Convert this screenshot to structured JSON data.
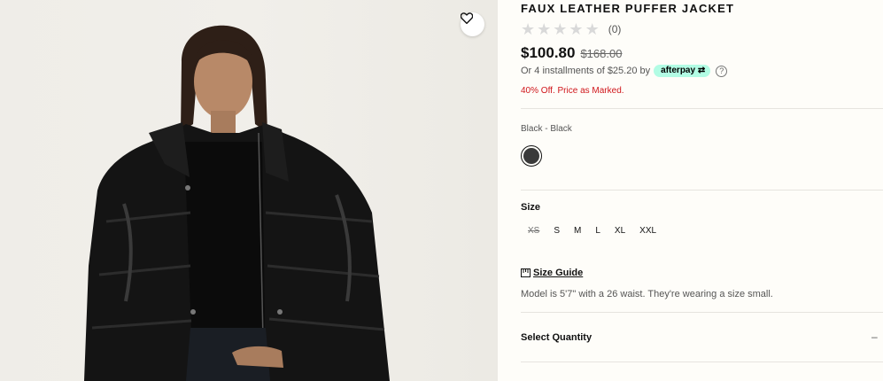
{
  "product": {
    "title": "FAUX LEATHER PUFFER JACKET",
    "rating_count": "(0)",
    "price": "$100.80",
    "original_price": "$168.00",
    "installments_text": "Or 4 installments of $25.20 by",
    "afterpay_label": "afterpay",
    "help_icon": "?",
    "promo": "40% Off. Price as Marked.",
    "wishlist_icon": "heart-icon"
  },
  "color": {
    "label": "Black - Black",
    "swatch_hex": "#3a3a3a"
  },
  "size": {
    "label": "Size",
    "options": [
      "XS",
      "S",
      "M",
      "L",
      "XL",
      "XXL"
    ],
    "unavailable": [
      "XS"
    ]
  },
  "size_guide": {
    "label": "Size Guide",
    "icon": "ruler-icon"
  },
  "model_note": "Model is 5'7\" with a 26 waist. They're wearing a size small.",
  "quantity": {
    "label": "Select Quantity",
    "toggle": "–"
  },
  "colors": {
    "promo_red": "#d0161b",
    "afterpay_mint": "#b2fce4",
    "background": "#fefdf9"
  }
}
